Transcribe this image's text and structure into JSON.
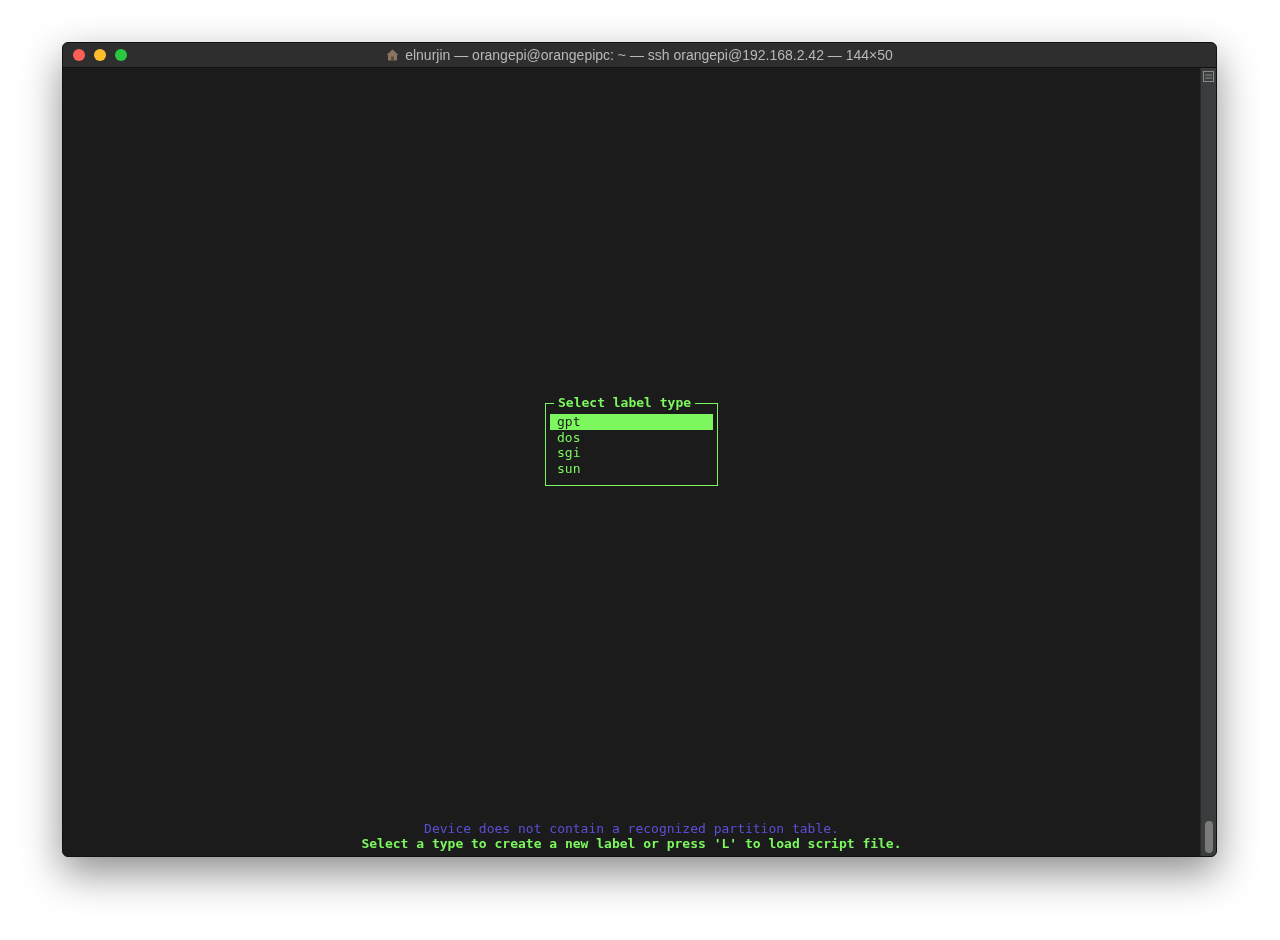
{
  "window": {
    "title": "elnurjin — orangepi@orangepipc: ~ — ssh orangepi@192.168.2.42 — 144×50"
  },
  "dialog": {
    "title": "Select label type",
    "items": [
      {
        "label": "gpt",
        "selected": true
      },
      {
        "label": "dos",
        "selected": false
      },
      {
        "label": "sgi",
        "selected": false
      },
      {
        "label": "sun",
        "selected": false
      }
    ]
  },
  "messages": [
    {
      "text": "Device does not contain a recognized partition table.",
      "kind": "info"
    },
    {
      "text": "Select a type to create a new label or press 'L' to load script file.",
      "kind": "prompt"
    }
  ]
}
